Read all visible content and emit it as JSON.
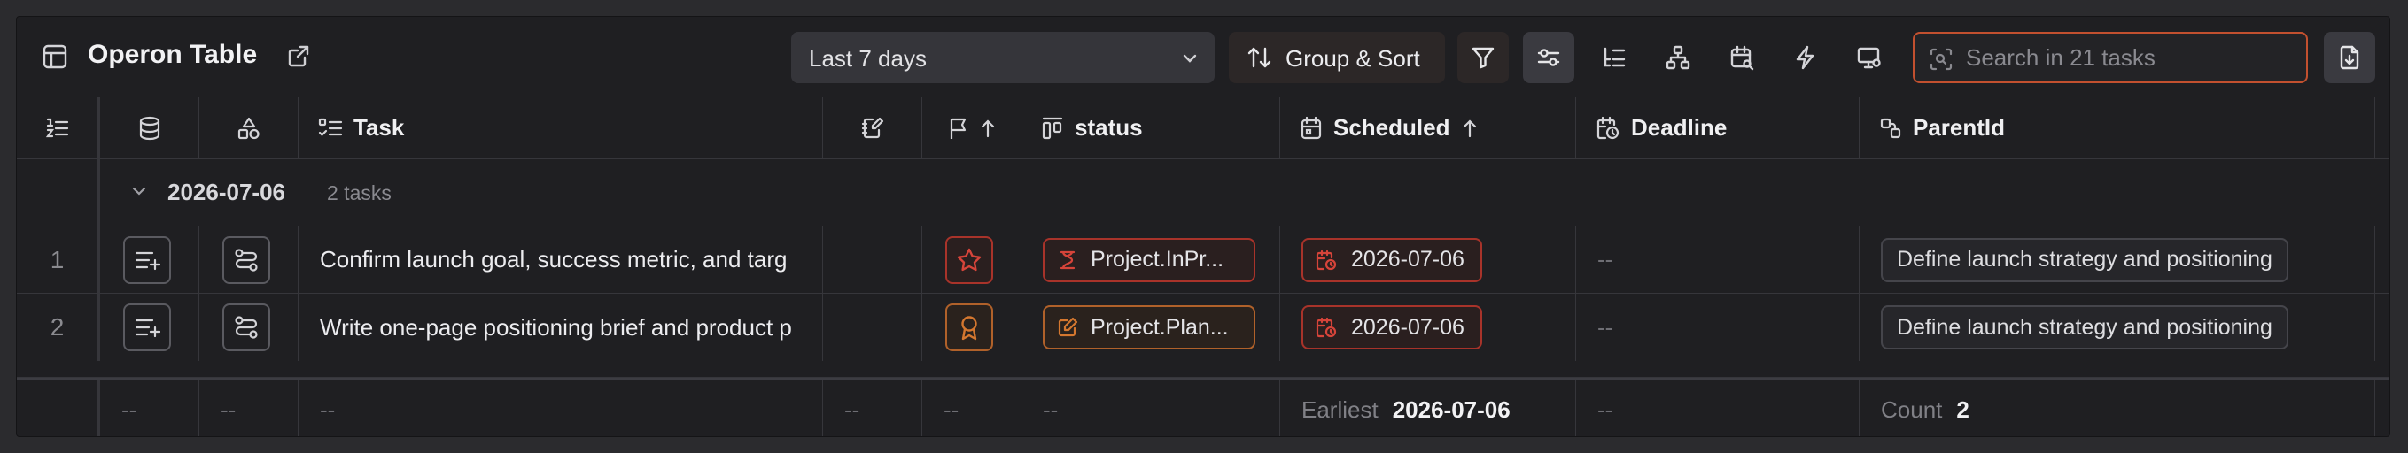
{
  "toolbar": {
    "title": "Operon Table",
    "range_value": "Last 7 days",
    "group_sort_label": "Group & Sort",
    "search_placeholder": "Search in 21 tasks"
  },
  "columns": {
    "task": "Task",
    "status": "status",
    "scheduled": "Scheduled",
    "deadline": "Deadline",
    "parent": "ParentId"
  },
  "group": {
    "label": "2026-07-06",
    "count": "2 tasks"
  },
  "rows": [
    {
      "num": "1",
      "task": "Confirm launch goal, success metric, and targ",
      "status": "Project.InPr...",
      "scheduled": "2026-07-06",
      "deadline": "--",
      "parent": "Define launch strategy and positioning"
    },
    {
      "num": "2",
      "task": "Write one-page positioning brief and product p",
      "status": "Project.Plan...",
      "scheduled": "2026-07-06",
      "deadline": "--",
      "parent": "Define launch strategy and positioning"
    }
  ],
  "footer": {
    "empty": "--",
    "scheduled_label": "Earliest",
    "scheduled_value": "2026-07-06",
    "parent_label": "Count",
    "parent_value": "2"
  },
  "colors": {
    "accent_red": "#a8332a",
    "accent_orange": "#b0612a",
    "search_border": "#c2502f"
  }
}
